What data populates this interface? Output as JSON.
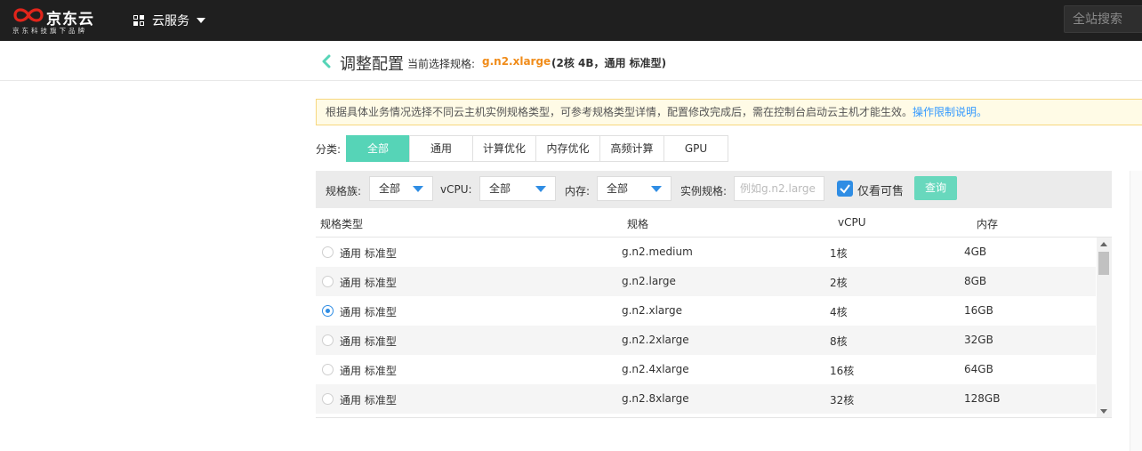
{
  "header": {
    "brand_name": "京东云",
    "brand_tagline": "京东科技旗下品牌",
    "services_label": "云服务",
    "search_placeholder": "全站搜索"
  },
  "page": {
    "title": "调整配置",
    "current_label": "当前选择规格:",
    "current_spec": "g.n2.xlarge",
    "current_desc": "(2核 4B，通用 标准型)"
  },
  "notice": {
    "text": "根据具体业务情况选择不同云主机实例规格类型，可参考规格类型详情，配置修改完成后，需在控制台启动云主机才能生效。",
    "link": "操作限制说明。"
  },
  "category": {
    "label": "分类:",
    "items": [
      "全部",
      "通用",
      "计算优化",
      "内存优化",
      "高频计算",
      "GPU"
    ],
    "active": "全部"
  },
  "filters": {
    "family_label": "规格族:",
    "family_value": "全部",
    "vcpu_label": "vCPU:",
    "vcpu_value": "全部",
    "mem_label": "内存:",
    "mem_value": "全部",
    "instance_label": "实例规格:",
    "instance_placeholder": "例如g.n2.large",
    "available_only_label": "仅看可售",
    "available_only": true,
    "query_button": "查询"
  },
  "table": {
    "columns": [
      "规格类型",
      "规格",
      "vCPU",
      "内存"
    ],
    "rows": [
      {
        "type": "通用 标准型",
        "spec": "g.n2.medium",
        "vcpu": "1核",
        "mem": "4GB",
        "selected": false
      },
      {
        "type": "通用 标准型",
        "spec": "g.n2.large",
        "vcpu": "2核",
        "mem": "8GB",
        "selected": false
      },
      {
        "type": "通用 标准型",
        "spec": "g.n2.xlarge",
        "vcpu": "4核",
        "mem": "16GB",
        "selected": true
      },
      {
        "type": "通用 标准型",
        "spec": "g.n2.2xlarge",
        "vcpu": "8核",
        "mem": "32GB",
        "selected": false
      },
      {
        "type": "通用 标准型",
        "spec": "g.n2.4xlarge",
        "vcpu": "16核",
        "mem": "64GB",
        "selected": false
      },
      {
        "type": "通用 标准型",
        "spec": "g.n2.8xlarge",
        "vcpu": "32核",
        "mem": "128GB",
        "selected": false
      }
    ]
  },
  "colors": {
    "accent": "#56d4b7",
    "primary": "#2f8de4",
    "highlight": "#f08c1a",
    "topbar": "#1f1f1f"
  }
}
